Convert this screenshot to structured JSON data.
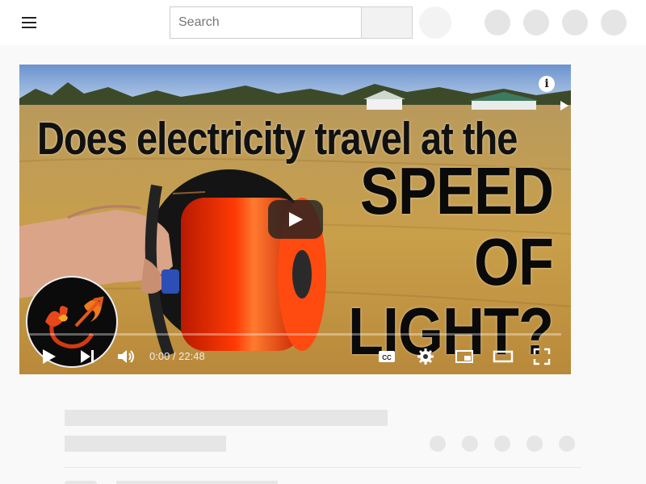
{
  "topbar": {
    "search": {
      "placeholder": "Search",
      "value": ""
    },
    "icons": [
      "menu-icon",
      "search-icon",
      "mic-icon",
      "create-icon",
      "apps-icon",
      "notifications-icon",
      "avatar"
    ]
  },
  "player": {
    "thumbnail_text": {
      "line1": "Does electricity travel at the",
      "line2": "SPEED",
      "line3": "OF",
      "line4": "LIGHT?"
    },
    "info_label": "i",
    "time": "0:00 / 22:48",
    "progress": 0.0,
    "colors": {
      "spool_wire": "#ff2a00",
      "spool_rim": "#151515",
      "sky": "#7fa3d8",
      "grass": "#c79a46"
    }
  }
}
